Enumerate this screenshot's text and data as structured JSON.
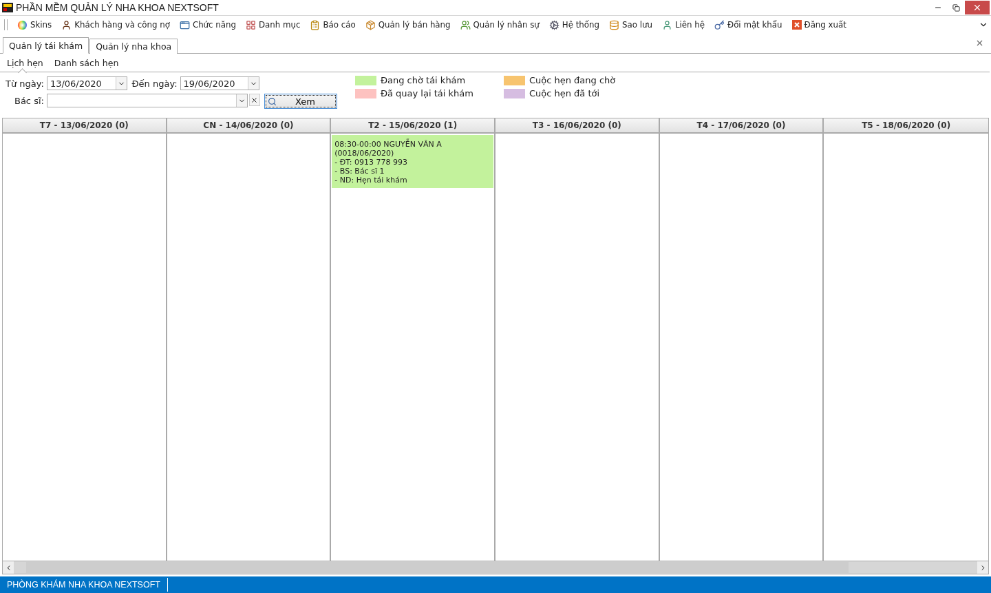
{
  "window": {
    "title": "PHẦN MỀM QUẢN LÝ NHA KHOA NEXTSOFT"
  },
  "menu": [
    {
      "label": "Skins"
    },
    {
      "label": "Khách hàng và công nợ"
    },
    {
      "label": "Chức năng"
    },
    {
      "label": "Danh mục"
    },
    {
      "label": "Báo cáo"
    },
    {
      "label": "Quản lý bán hàng"
    },
    {
      "label": "Quản lý nhân sự"
    },
    {
      "label": "Hệ thống"
    },
    {
      "label": "Sao lưu"
    },
    {
      "label": "Liên hệ"
    },
    {
      "label": "Đổi mật khẩu"
    },
    {
      "label": "Đăng xuất"
    }
  ],
  "tabs": [
    {
      "label": "Quản lý tái khám",
      "selected": true
    },
    {
      "label": "Quản lý nha khoa",
      "selected": false
    }
  ],
  "subtabs": [
    {
      "label": "Lịch hẹn",
      "selected": true
    },
    {
      "label": "Danh sách hẹn",
      "selected": false
    }
  ],
  "filters": {
    "from_label": "Từ ngày:",
    "from_value": "13/06/2020",
    "to_label": "Đến ngày:",
    "to_value": "19/06/2020",
    "doctor_label": "Bác sĩ:",
    "view_button": "Xem"
  },
  "legend": [
    {
      "label": "Đang chờ tái khám",
      "color": "#c3f29c"
    },
    {
      "label": "Cuộc hẹn đang chờ",
      "color": "#f7c46f"
    },
    {
      "label": "Đã quay lại tái khám",
      "color": "#fdc2c0"
    },
    {
      "label": "Cuộc hẹn đã tới",
      "color": "#d6bde1"
    }
  ],
  "days": [
    {
      "header": "T7 - 13/06/2020 (0)"
    },
    {
      "header": "CN - 14/06/2020 (0)"
    },
    {
      "header": "T2 - 15/06/2020 (1)",
      "appointments": [
        {
          "color": "#c3f29c",
          "lines": [
            "08:30-00:00 NGUYỄN VĂN A",
            "(0018/06/2020)",
            "- ĐT: 0913 778 993",
            "- BS: Bác sĩ 1",
            "- ND: Hẹn tái khám"
          ]
        }
      ]
    },
    {
      "header": "T3 - 16/06/2020 (0)"
    },
    {
      "header": "T4 - 17/06/2020 (0)"
    },
    {
      "header": "T5 - 18/06/2020 (0)"
    }
  ],
  "status_bar": {
    "text": "PHÒNG KHÁM NHA KHOA NEXTSOFT"
  }
}
